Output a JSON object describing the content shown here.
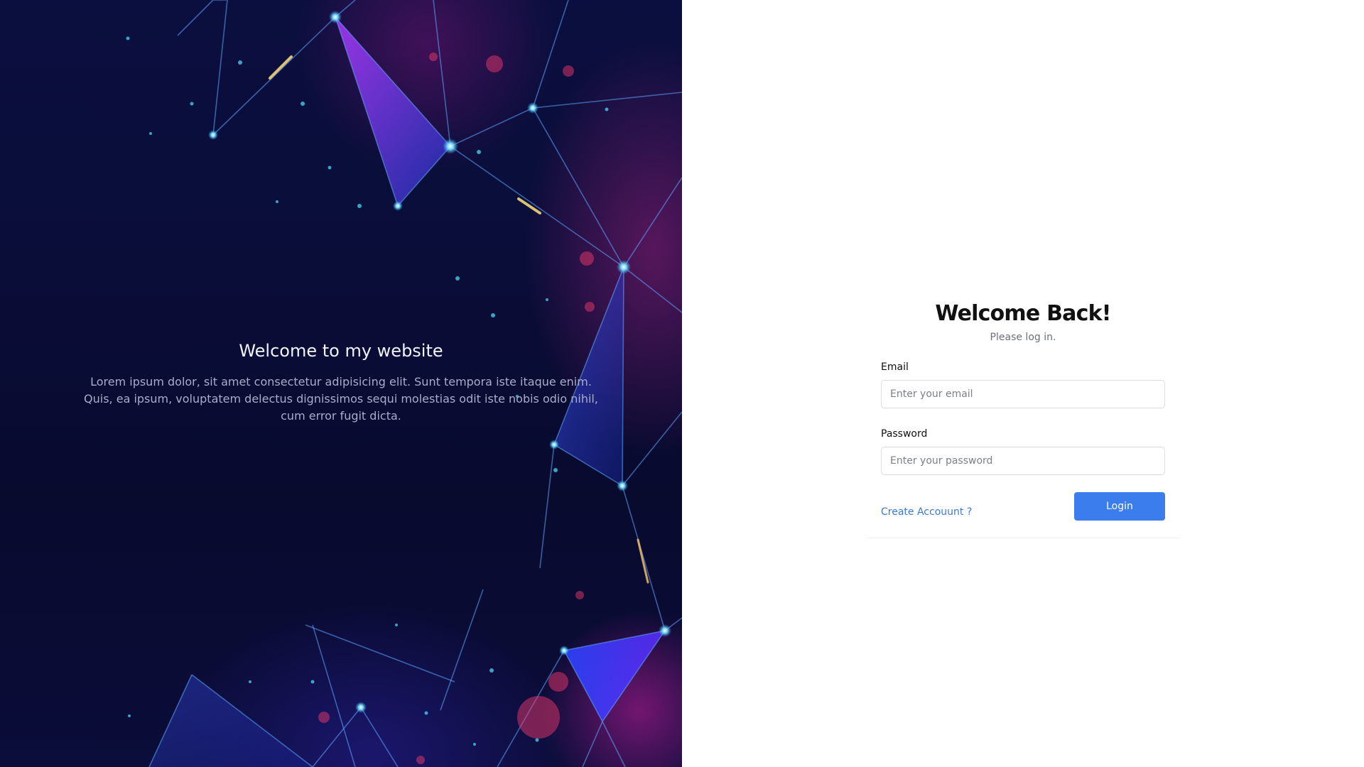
{
  "hero": {
    "title": "Welcome to my website",
    "text": "Lorem ipsum dolor, sit amet consectetur adipisicing elit. Sunt tempora iste itaque enim. Quis, ea ipsum, voluptatem delectus dignissimos sequi molestias odit iste nobis odio nihil, cum error fugit dicta."
  },
  "login": {
    "title": "Welcome Back!",
    "subtitle": "Please log in.",
    "email_label": "Email",
    "email_placeholder": "Enter your email",
    "email_value": "",
    "password_label": "Password",
    "password_placeholder": "Enter your password",
    "password_value": "",
    "create_account_label": "Create Accouunt ?",
    "login_button_label": "Login"
  },
  "colors": {
    "accent": "#3b7ded",
    "link": "#3a79d9",
    "hero_background": "#0a0d38"
  },
  "icons": {
    "hero_background": "network-constellation-image"
  }
}
